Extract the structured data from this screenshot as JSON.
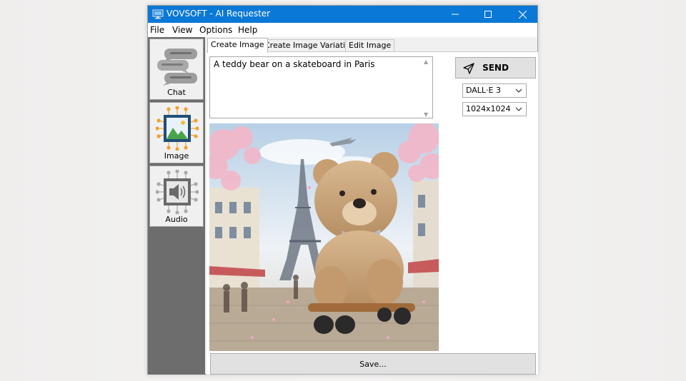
{
  "window": {
    "title": "VOVSOFT - AI Requester"
  },
  "menu": {
    "file": "File",
    "view": "View",
    "options": "Options",
    "help": "Help"
  },
  "sidebar": {
    "chat": "Chat",
    "image": "Image",
    "audio": "Audio"
  },
  "tabs": {
    "create_image": "Create Image",
    "create_variation": "Create Image Variation",
    "edit_image": "Edit Image"
  },
  "prompt": {
    "value": "A teddy bear on a skateboard in Paris"
  },
  "send": {
    "label": "SEND"
  },
  "model": {
    "selected": "DALL·E 3"
  },
  "size": {
    "selected": "1024x1024"
  },
  "save": {
    "label": "Save..."
  },
  "colors": {
    "titlebar": "#0a78d6",
    "sidebar": "#6d6d6d",
    "icon_orange": "#f0a030",
    "icon_navy": "#1f4e79"
  },
  "icons": {
    "app": "app-monitor-icon",
    "chat": "chat-bubbles-icon",
    "image": "image-network-icon",
    "audio": "speaker-network-icon",
    "send": "paper-plane-icon"
  }
}
